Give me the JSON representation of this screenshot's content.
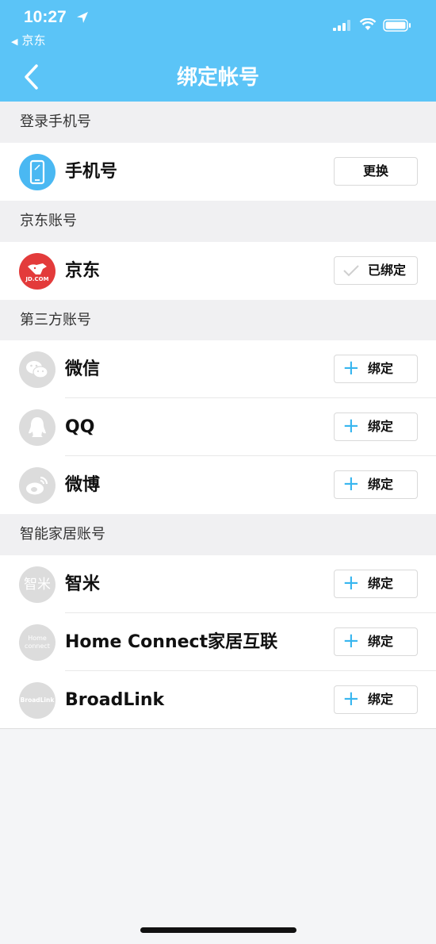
{
  "status_bar": {
    "time": "10:27",
    "back_app": "京东",
    "icons": [
      "location-arrow-icon",
      "signal-icon",
      "wifi-icon",
      "battery-icon"
    ]
  },
  "nav": {
    "title": "绑定帐号",
    "back_icon": "chevron-left-icon"
  },
  "colors": {
    "header": "#5bc4f7",
    "accent_plus": "#38b6ef",
    "jd_red": "#e33b3b",
    "phone_blue": "#4ab8f2"
  },
  "sections": {
    "login_phone": {
      "title": "登录手机号",
      "rows": [
        {
          "label": "手机号",
          "button": "更换",
          "icon": "phone-icon"
        }
      ]
    },
    "jd": {
      "title": "京东账号",
      "rows": [
        {
          "label": "京东",
          "button": "已绑定",
          "icon": "jd-logo-icon",
          "icon_text": "JD.COM"
        }
      ]
    },
    "third_party": {
      "title": "第三方账号",
      "rows": [
        {
          "label": "微信",
          "button": "绑定",
          "icon": "wechat-icon"
        },
        {
          "label": "QQ",
          "button": "绑定",
          "icon": "qq-icon"
        },
        {
          "label": "微博",
          "button": "绑定",
          "icon": "weibo-icon"
        }
      ]
    },
    "smart_home": {
      "title": "智能家居账号",
      "rows": [
        {
          "label": "智米",
          "button": "绑定",
          "icon": "zhimi-icon",
          "icon_text": "智米"
        },
        {
          "label": "Home Connect家居互联",
          "button": "绑定",
          "icon": "home-connect-icon",
          "icon_text": "Home connect"
        },
        {
          "label": "BroadLink",
          "button": "绑定",
          "icon": "broadlink-icon",
          "icon_text": "BroadLink"
        }
      ]
    }
  }
}
